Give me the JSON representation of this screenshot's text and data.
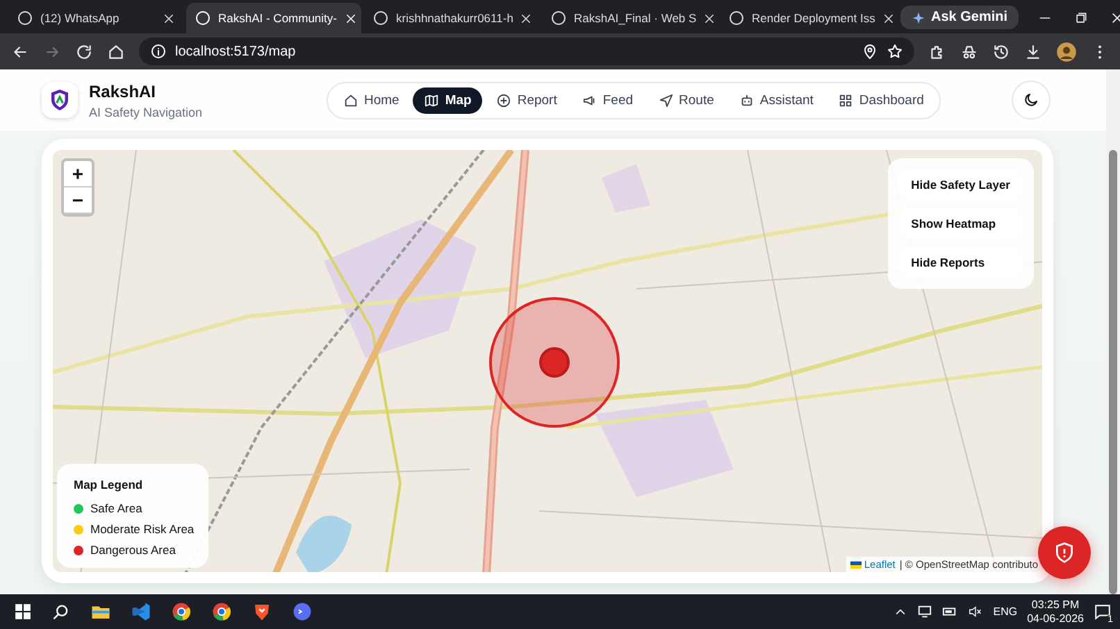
{
  "browser": {
    "tabs": [
      {
        "title": "(12) WhatsApp",
        "selected": false
      },
      {
        "title": "RakshAI - Community-",
        "selected": true
      },
      {
        "title": "krishhnathakurr0611-h",
        "selected": false
      },
      {
        "title": "RakshAI_Final · Web S",
        "selected": false
      },
      {
        "title": "Render Deployment Iss",
        "selected": false
      }
    ],
    "gemini": "Ask Gemini",
    "address": "localhost:5173/map"
  },
  "app": {
    "brand": "RakshAI",
    "tagline": "AI Safety Navigation",
    "nav": [
      {
        "label": "Home",
        "selected": false
      },
      {
        "label": "Map",
        "selected": true
      },
      {
        "label": "Report",
        "selected": false
      },
      {
        "label": "Feed",
        "selected": false
      },
      {
        "label": "Route",
        "selected": false
      },
      {
        "label": "Assistant",
        "selected": false
      },
      {
        "label": "Dashboard",
        "selected": false
      }
    ]
  },
  "map": {
    "zoom": [
      "+",
      "−"
    ],
    "layers": [
      "Hide Safety Layer",
      "Show Heatmap",
      "Hide Reports"
    ],
    "legend": {
      "title": "Map Legend",
      "items": [
        {
          "label": "Safe Area",
          "color": "#22c55e"
        },
        {
          "label": "Moderate Risk Area",
          "color": "#facc15"
        },
        {
          "label": "Dangerous Area",
          "color": "#dc2626"
        }
      ]
    },
    "attribution": {
      "link": "Leaflet",
      "text": "| © OpenStreetMap contributo"
    }
  },
  "taskbar": {
    "language": "ENG",
    "time": "03:25 PM",
    "date": "04-06-2026",
    "notifications": "1"
  }
}
